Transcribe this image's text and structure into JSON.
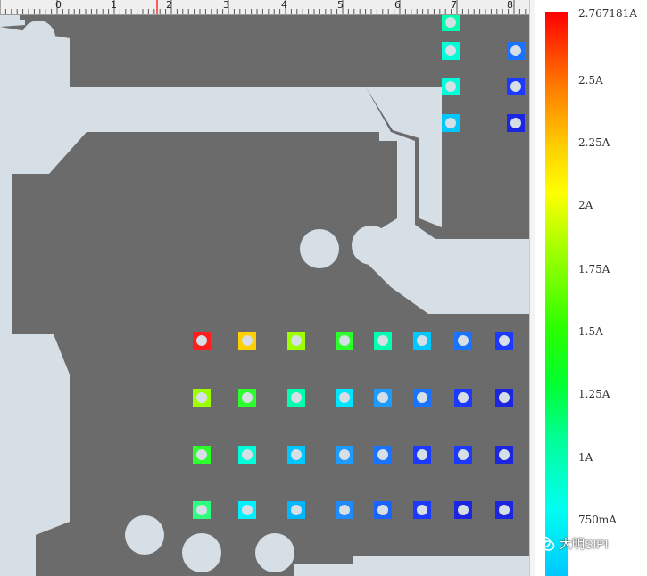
{
  "ruler": {
    "labels": [
      "0",
      "1",
      "2",
      "3",
      "4",
      "5",
      "6",
      "7",
      "8"
    ]
  },
  "legend": {
    "colors": {
      "max": "#ff0000",
      "min": "#00c8ff"
    },
    "labels": {
      "max": "2.767181A",
      "l2_5": "2.5A",
      "l2_25": "2.25A",
      "l2": "2A",
      "l1_75": "1.75A",
      "l1_5": "1.5A",
      "l1_25": "1.25A",
      "l1": "1A",
      "l750": "750mA"
    }
  },
  "watermark": {
    "text": "大明SIPI",
    "icon": "wechat-icon"
  },
  "colors": {
    "copper": "#6b6b6b",
    "board_bg": "#d6dee6"
  }
}
